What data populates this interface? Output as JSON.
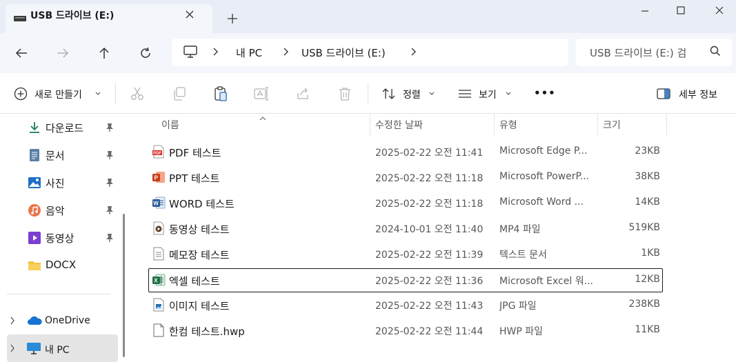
{
  "tab": {
    "title": "USB 드라이브 (E:)"
  },
  "nav": {
    "breadcrumb": [
      "내 PC",
      "USB 드라이브 (E:)"
    ],
    "search_placeholder": "USB 드라이브 (E:) 검"
  },
  "toolbar": {
    "new_label": "새로 만들기",
    "sort_label": "정렬",
    "view_label": "보기",
    "more_label": "•••",
    "details_label": "세부 정보"
  },
  "sidebar": {
    "items": [
      {
        "label": "다운로드",
        "icon": "download-icon",
        "pinned": true
      },
      {
        "label": "문서",
        "icon": "document-icon",
        "pinned": true
      },
      {
        "label": "사진",
        "icon": "picture-icon",
        "pinned": true
      },
      {
        "label": "음악",
        "icon": "music-icon",
        "pinned": true
      },
      {
        "label": "동영상",
        "icon": "video-icon",
        "pinned": true
      },
      {
        "label": "DOCX",
        "icon": "folder-icon",
        "pinned": false
      }
    ],
    "onedrive": "OneDrive",
    "this_pc": "내 PC"
  },
  "columns": {
    "name": "이름",
    "date": "수정한 날짜",
    "type": "유형",
    "size": "크기"
  },
  "files": [
    {
      "name": "PDF 테스트",
      "date": "2025-02-22 오전 11:41",
      "type": "Microsoft Edge P...",
      "size": "23KB",
      "icon": "pdf-icon"
    },
    {
      "name": "PPT 테스트",
      "date": "2025-02-22 오전 11:18",
      "type": "Microsoft PowerP...",
      "size": "38KB",
      "icon": "powerpoint-icon"
    },
    {
      "name": "WORD 테스트",
      "date": "2025-02-22 오전 11:18",
      "type": "Microsoft Word ...",
      "size": "14KB",
      "icon": "word-icon"
    },
    {
      "name": "동영상 테스트",
      "date": "2024-10-01 오전 11:40",
      "type": "MP4 파일",
      "size": "519KB",
      "icon": "video-file-icon"
    },
    {
      "name": "메모장 테스트",
      "date": "2025-02-22 오전 11:39",
      "type": "텍스트 문서",
      "size": "1KB",
      "icon": "text-file-icon"
    },
    {
      "name": "엑셀 테스트",
      "date": "2025-02-22 오전 11:36",
      "type": "Microsoft Excel 워...",
      "size": "12KB",
      "icon": "excel-icon",
      "selected": true
    },
    {
      "name": "이미지 테스트",
      "date": "2025-02-22 오전 11:43",
      "type": "JPG 파일",
      "size": "238KB",
      "icon": "image-file-icon"
    },
    {
      "name": "한컴 테스트.hwp",
      "date": "2025-02-22 오전 11:44",
      "type": "HWP 파일",
      "size": "11KB",
      "icon": "hwp-file-icon"
    }
  ]
}
